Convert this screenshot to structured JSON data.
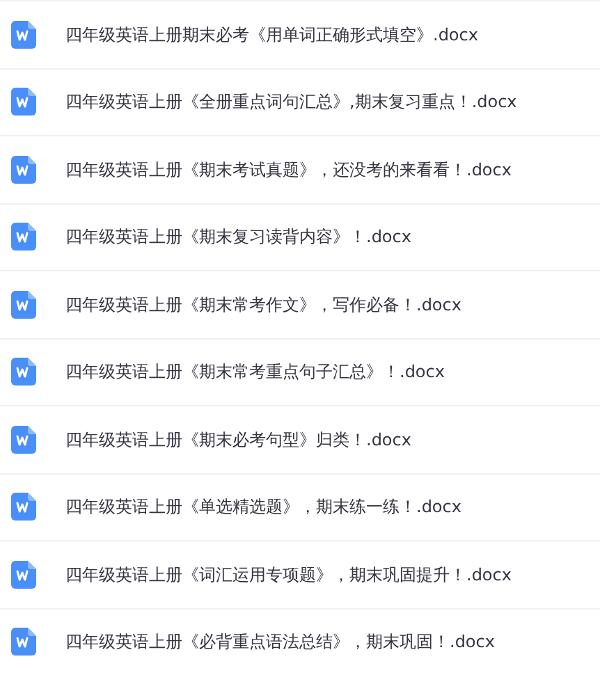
{
  "files": [
    {
      "name": "四年级英语上册期末必考《用单词正确形式填空》.docx"
    },
    {
      "name": "四年级英语上册《全册重点词句汇总》,期末复习重点！.docx"
    },
    {
      "name": "四年级英语上册《期末考试真题》，还没考的来看看！.docx"
    },
    {
      "name": "四年级英语上册《期末复习读背内容》！.docx"
    },
    {
      "name": "四年级英语上册《期末常考作文》，写作必备！.docx"
    },
    {
      "name": "四年级英语上册《期末常考重点句子汇总》！.docx"
    },
    {
      "name": "四年级英语上册《期末必考句型》归类！.docx"
    },
    {
      "name": "四年级英语上册《单选精选题》，期末练一练！.docx"
    },
    {
      "name": "四年级英语上册《词汇运用专项题》，期末巩固提升！.docx"
    },
    {
      "name": "四年级英语上册《必背重点语法总结》，期末巩固！.docx"
    }
  ]
}
